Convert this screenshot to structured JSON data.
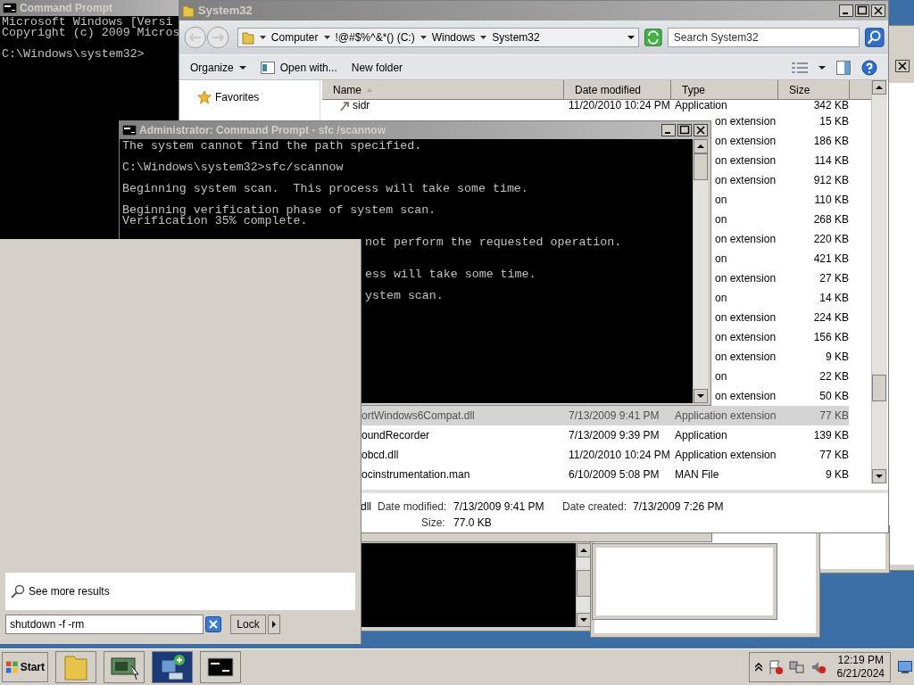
{
  "console_window": {
    "title": "Command Prompt",
    "lines": [
      {
        "kind": "text",
        "text": "Microsoft Windows [Versi"
      },
      {
        "kind": "text",
        "text": "Copyright (c) 2009 Micros"
      },
      {
        "kind": "blank"
      },
      {
        "kind": "text",
        "text": "C:\\Windows\\system32>"
      }
    ]
  },
  "explorer": {
    "title": "System32",
    "breadcrumbs": [
      "Computer",
      "!@#$%^&*() (C:)",
      "Windows",
      "System32"
    ],
    "search": {
      "placeholder": "Search System32"
    },
    "toolbar": [
      {
        "kind": "menu",
        "label": "Organize"
      },
      {
        "kind": "open",
        "label": "Open with..."
      },
      {
        "kind": "plain",
        "label": "New folder"
      }
    ],
    "nav_items": [
      "Favorites"
    ],
    "columns": [
      "Name",
      "Date modified",
      "Type",
      "Size"
    ],
    "rows": [
      {
        "kind": "top",
        "name": "sidr",
        "date": "11/20/2010 10:24 PM",
        "type": "Application",
        "size": "342 KB",
        "selected": false
      },
      {
        "kind": "covered",
        "type": "on extension",
        "size": "15 KB",
        "selected": false
      },
      {
        "kind": "covered",
        "type": "on extension",
        "size": "186 KB",
        "selected": false
      },
      {
        "kind": "covered",
        "type": "on extension",
        "size": "114 KB",
        "selected": false
      },
      {
        "kind": "covered",
        "type": "on extension",
        "size": "912 KB",
        "selected": false
      },
      {
        "kind": "covered",
        "type": "on",
        "size": "110 KB",
        "selected": false
      },
      {
        "kind": "covered",
        "type": "on",
        "size": "268 KB",
        "selected": false
      },
      {
        "kind": "covered",
        "type": "on extension",
        "size": "220 KB",
        "selected": false
      },
      {
        "kind": "covered",
        "type": "on",
        "size": "421 KB",
        "selected": false
      },
      {
        "kind": "covered",
        "type": "on extension",
        "size": "27 KB",
        "selected": false
      },
      {
        "kind": "covered",
        "type": "on",
        "size": "14 KB",
        "selected": false
      },
      {
        "kind": "covered",
        "type": "on extension",
        "size": "224 KB",
        "selected": false
      },
      {
        "kind": "covered",
        "type": "on extension",
        "size": "156 KB",
        "selected": false
      },
      {
        "kind": "covered",
        "type": "on extension",
        "size": "9 KB",
        "selected": false
      },
      {
        "kind": "covered",
        "type": "on",
        "size": "22 KB",
        "selected": false
      },
      {
        "kind": "covered",
        "type": "on extension",
        "size": "50 KB",
        "selected": false
      },
      {
        "kind": "cut",
        "name": "ortWindows6Compat.dll",
        "date": "7/13/2009 9:41 PM",
        "type": "Application extension",
        "size": "77 KB",
        "selected": true
      },
      {
        "kind": "cut",
        "name": "oundRecorder",
        "date": "7/13/2009 9:39 PM",
        "type": "Application",
        "size": "139 KB",
        "selected": false
      },
      {
        "kind": "cut",
        "name": "obcd.dll",
        "date": "11/20/2010 10:24 PM",
        "type": "Application extension",
        "size": "77 KB",
        "selected": false
      },
      {
        "kind": "cut",
        "name": "ocinstrumentation.man",
        "date": "6/10/2009 5:08 PM",
        "type": "MAN File",
        "size": "9 KB",
        "selected": false
      }
    ],
    "details": {
      "name": "dll",
      "fields": [
        {
          "label": "Date modified:",
          "value": "7/13/2009 9:41 PM"
        },
        {
          "label": "Date created:",
          "value": "7/13/2009 7:26 PM"
        },
        {
          "label": "Size:",
          "value": "77.0 KB"
        }
      ]
    }
  },
  "admin_console": {
    "title": "Administrator: Command Prompt - sfc /scannow",
    "lines": [
      {
        "kind": "text",
        "text": "The system cannot find the path specified."
      },
      {
        "kind": "blank"
      },
      {
        "kind": "text",
        "text": "C:\\Windows\\system32>sfc/scannow"
      },
      {
        "kind": "blank"
      },
      {
        "kind": "text",
        "text": "Beginning system scan.  This process will take some time."
      },
      {
        "kind": "blank"
      },
      {
        "kind": "text",
        "text": "Beginning verification phase of system scan."
      },
      {
        "kind": "text",
        "text": "Verification 35% complete."
      },
      {
        "kind": "blank"
      },
      {
        "kind": "cut",
        "text": "not perform the requested operation."
      },
      {
        "kind": "blank"
      },
      {
        "kind": "blank"
      },
      {
        "kind": "cut",
        "text": "ess will take some time."
      },
      {
        "kind": "blank"
      },
      {
        "kind": "cut",
        "text": "ystem scan."
      }
    ]
  },
  "start_menu": {
    "more_results": "See more results",
    "search": {
      "value": "shutdown -f -rm"
    },
    "power_button": "Lock"
  },
  "taskbar": {
    "start": "Start",
    "tasks": [
      {
        "kind": "folder"
      },
      {
        "kind": "server"
      },
      {
        "kind": "network"
      },
      {
        "kind": "console"
      }
    ],
    "clock": {
      "time": "12:19 PM",
      "date": "6/21/2024"
    }
  }
}
